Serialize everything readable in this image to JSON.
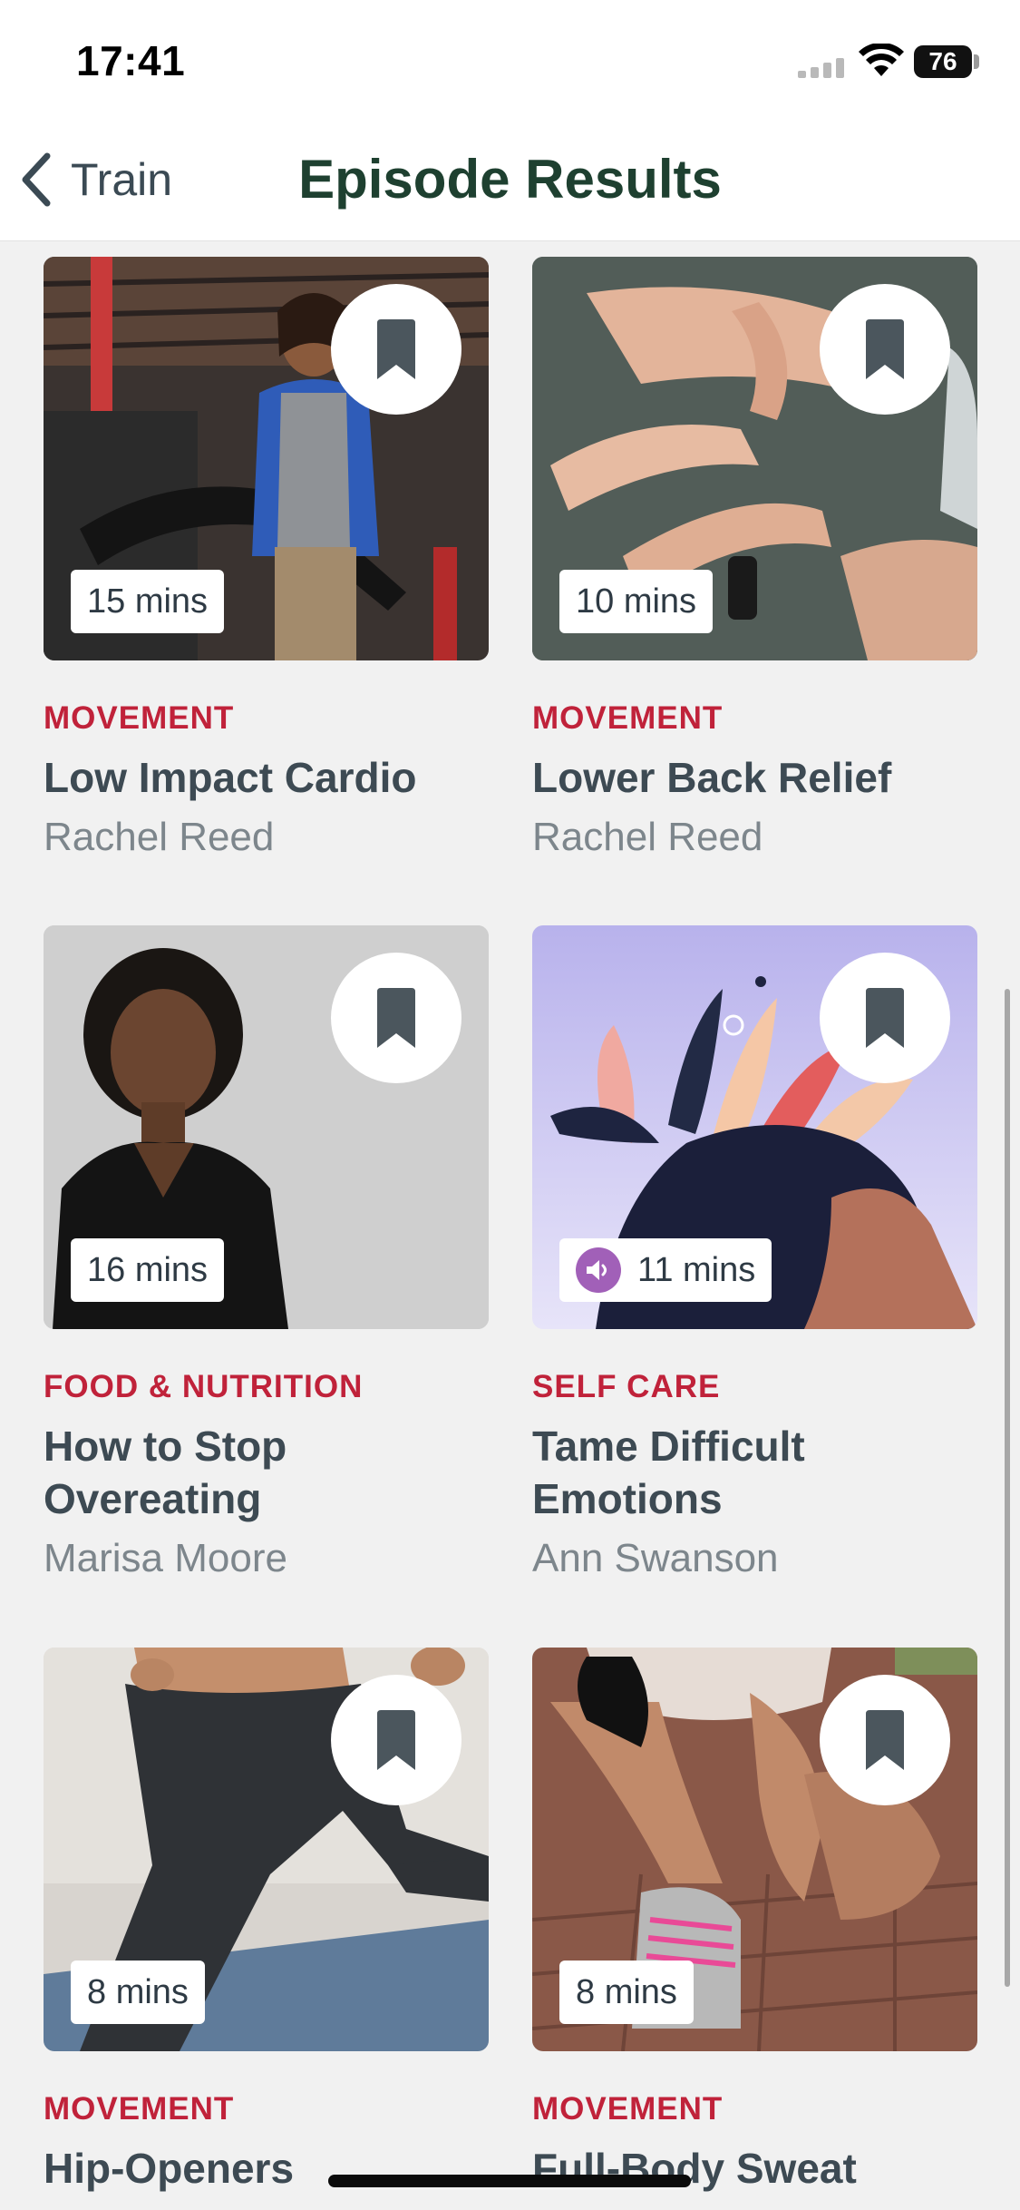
{
  "status_bar": {
    "time": "17:41",
    "battery": "76",
    "icons": [
      "signal-icon",
      "wifi-icon",
      "battery-icon"
    ]
  },
  "nav": {
    "back_label": "Train",
    "title": "Episode Results",
    "back_icon": "chevron-left-icon"
  },
  "colors": {
    "title_green": "#1e4030",
    "category_red": "#c0223a",
    "audio_purple": "#a160b8",
    "background": "#f1f1f1"
  },
  "episodes": [
    {
      "duration": "15 mins",
      "category": "MOVEMENT",
      "title": "Low Impact Cardio",
      "author": "Rachel Reed",
      "audio": false
    },
    {
      "duration": "10 mins",
      "category": "MOVEMENT",
      "title": "Lower Back Relief",
      "author": "Rachel Reed",
      "audio": false
    },
    {
      "duration": "16 mins",
      "category": "FOOD & NUTRITION",
      "title": "How to Stop Overeating",
      "author": "Marisa Moore",
      "audio": false
    },
    {
      "duration": "11 mins",
      "category": "SELF CARE",
      "title": "Tame Difficult Emotions",
      "author": "Ann Swanson",
      "audio": true
    },
    {
      "duration": "8 mins",
      "category": "MOVEMENT",
      "title": "Hip-Openers",
      "author": "",
      "audio": false
    },
    {
      "duration": "8 mins",
      "category": "MOVEMENT",
      "title": "Full-Body Sweat",
      "author": "",
      "audio": false
    }
  ]
}
